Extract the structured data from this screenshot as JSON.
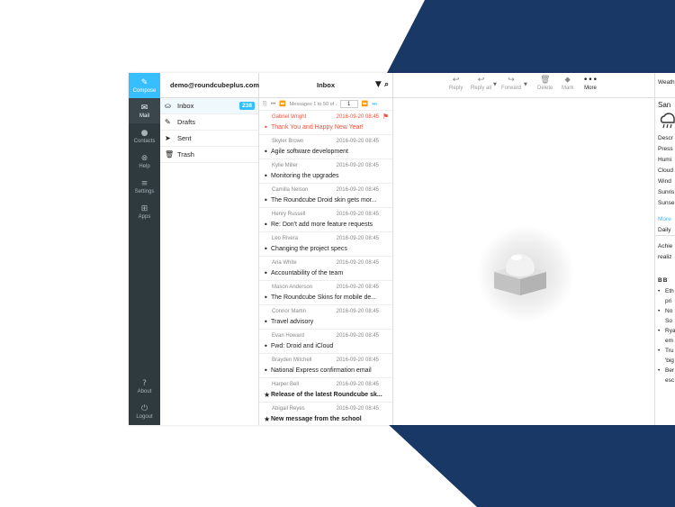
{
  "nav": {
    "compose": "Compose",
    "mail": "Mail",
    "contacts": "Contacts",
    "help": "Help",
    "settings": "Settings",
    "apps": "Apps",
    "about": "About",
    "logout": "Logout"
  },
  "account": "demo@roundcubeplus.com",
  "folders": [
    {
      "label": "Inbox",
      "badge": "238",
      "icon": "inbox-icon"
    },
    {
      "label": "Drafts",
      "icon": "pencil-icon"
    },
    {
      "label": "Sent",
      "icon": "paper-plane-icon"
    },
    {
      "label": "Trash",
      "icon": "trash-icon"
    }
  ],
  "list": {
    "title": "Inbox",
    "pager_text": "Messages 1 to 50 of ...",
    "page": "1",
    "messages": [
      {
        "from": "Gabriel Wright",
        "date": "2016-09-20 08:45",
        "subject": "Thank You and Happy New Year!",
        "flagged": true
      },
      {
        "from": "Skyler Brown",
        "date": "2016-09-20 08:45",
        "subject": "Agile software development"
      },
      {
        "from": "Kylie Miller",
        "date": "2016-09-20 08:45",
        "subject": "Monitoring the upgrades"
      },
      {
        "from": "Camilla Nelson",
        "date": "2016-09-20 08:45",
        "subject": "The Roundcube Droid skin gets mor..."
      },
      {
        "from": "Henry Russell",
        "date": "2016-09-20 08:45",
        "subject": "Re: Don't add more feature requests"
      },
      {
        "from": "Leo Rivera",
        "date": "2016-09-20 08:45",
        "subject": "Changing the project specs"
      },
      {
        "from": "Aria White",
        "date": "2016-09-20 08:45",
        "subject": "Accountability of the team"
      },
      {
        "from": "Mason Anderson",
        "date": "2016-09-20 08:45",
        "subject": "The Roundcube Skins for mobile de..."
      },
      {
        "from": "Connor Martin",
        "date": "2016-09-20 08:45",
        "subject": "Travel advisory"
      },
      {
        "from": "Evan Howard",
        "date": "2016-09-20 08:45",
        "subject": "Fwd: Droid and iCloud"
      },
      {
        "from": "Brayden Mitchell",
        "date": "2016-09-20 08:45",
        "subject": "National Express confirmation email"
      },
      {
        "from": "Harper Bell",
        "date": "2016-09-20 08:45",
        "subject": "Release of the latest Roundcube sk...",
        "unread": true
      },
      {
        "from": "Abigail Reyes",
        "date": "2016-09-20 08:45",
        "subject": "New message from the school",
        "unread": true
      }
    ]
  },
  "toolbar": {
    "reply": "Reply",
    "reply_all": "Reply all",
    "forward": "Forward",
    "delete": "Delete",
    "mark": "Mark",
    "more": "More"
  },
  "side": {
    "header": "Weath",
    "city": "San",
    "lines": [
      "Descr",
      "Press",
      "Humi",
      "Cloud",
      "Wind",
      "Sunris",
      "Sunse"
    ],
    "more": "More",
    "daily": "Daily",
    "achieve": "Achie",
    "realiz": "realiz",
    "bbc": "BB",
    "bullets": [
      "Eth",
      "pri",
      "No",
      "So",
      "Rya",
      "em",
      "Tru",
      "'big",
      "Ber",
      "esc"
    ]
  },
  "colors": {
    "accent": "#37beff",
    "nav_bg": "#2f3a3f",
    "backdrop": "#1a3865",
    "flag": "#f0513c"
  }
}
